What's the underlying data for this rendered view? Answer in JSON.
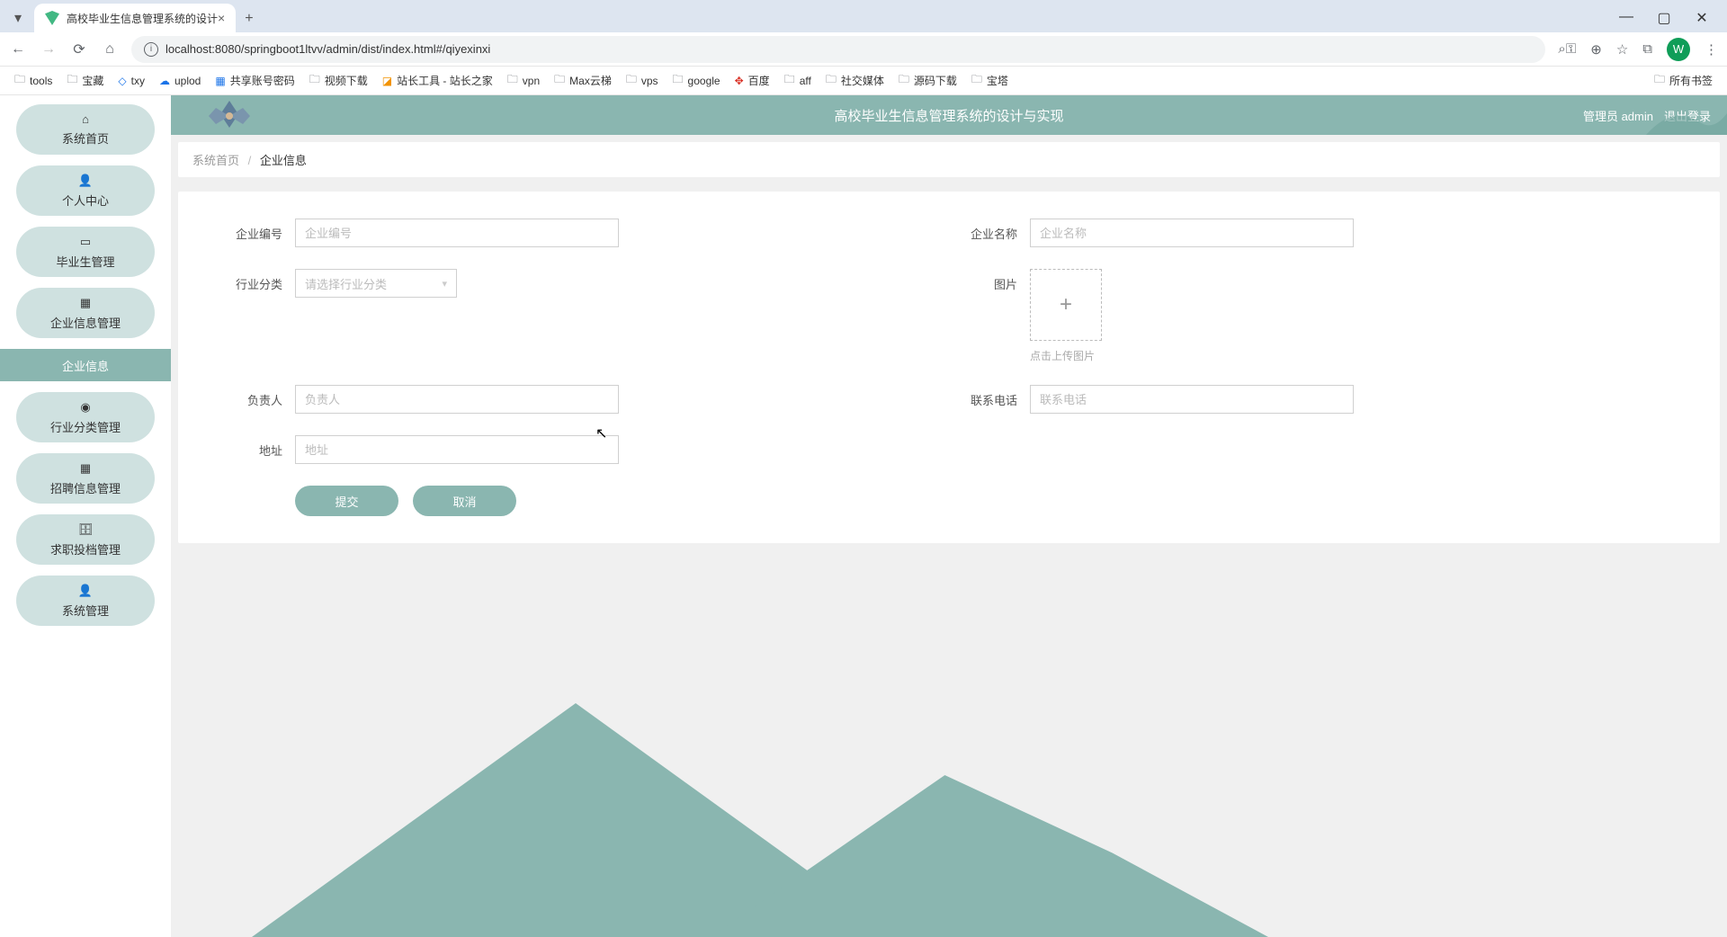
{
  "browser": {
    "tab_title": "高校毕业生信息管理系统的设计",
    "url": "localhost:8080/springboot1ltvv/admin/dist/index.html#/qiyexinxi",
    "bookmarks": [
      "tools",
      "宝藏",
      "txy",
      "uplod",
      "共享账号密码",
      "视频下载",
      "站长工具 - 站长之家",
      "vpn",
      "Max云梯",
      "vps",
      "google",
      "百度",
      "aff",
      "社交媒体",
      "源码下载",
      "宝塔"
    ],
    "bookmarks_right": "所有书签",
    "avatar_letter": "W"
  },
  "header": {
    "title": "高校毕业生信息管理系统的设计与实现",
    "user_label": "管理员 admin",
    "logout": "退出登录"
  },
  "sidebar": {
    "items": [
      {
        "label": "系统首页",
        "icon": "home"
      },
      {
        "label": "个人中心",
        "icon": "user"
      },
      {
        "label": "毕业生管理",
        "icon": "display"
      },
      {
        "label": "企业信息管理",
        "icon": "grid"
      },
      {
        "label": "企业信息",
        "sub": true
      },
      {
        "label": "行业分类管理",
        "icon": "tag"
      },
      {
        "label": "招聘信息管理",
        "icon": "grid2"
      },
      {
        "label": "求职投档管理",
        "icon": "briefcase"
      },
      {
        "label": "系统管理",
        "icon": "person"
      }
    ]
  },
  "breadcrumb": {
    "root": "系统首页",
    "current": "企业信息"
  },
  "form": {
    "qybh_label": "企业编号",
    "qybh_ph": "企业编号",
    "qymc_label": "企业名称",
    "qymc_ph": "企业名称",
    "hyfl_label": "行业分类",
    "hyfl_ph": "请选择行业分类",
    "tp_label": "图片",
    "tp_hint": "点击上传图片",
    "fzr_label": "负责人",
    "fzr_ph": "负责人",
    "lxdh_label": "联系电话",
    "lxdh_ph": "联系电话",
    "dz_label": "地址",
    "dz_ph": "地址",
    "submit": "提交",
    "cancel": "取消"
  }
}
